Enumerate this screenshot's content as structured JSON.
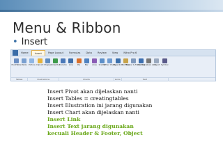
{
  "slide": {
    "title": "Menu & Ribbon",
    "bullet": "Insert"
  },
  "ribbon": {
    "tabs": [
      "Home",
      "Insert",
      "Page Layout",
      "Formulas",
      "Data",
      "Review",
      "View",
      "Nitro Pro 6"
    ],
    "active_tab": "Insert",
    "tools": [
      {
        "label": "PivotTable",
        "color": "#6b8fc4"
      },
      {
        "label": "Table",
        "color": "#7aa0d0"
      },
      {
        "label": "Picture",
        "color": "#8fb6e3"
      },
      {
        "label": "Clip Art",
        "color": "#e6b23a"
      },
      {
        "label": "Shapes",
        "color": "#5f8cc0"
      },
      {
        "label": "SmartArt",
        "color": "#3d9a4a"
      },
      {
        "label": "Column",
        "color": "#4a78b8"
      },
      {
        "label": "Line",
        "color": "#3f6ea9"
      },
      {
        "label": "Pie",
        "color": "#d96f2b"
      },
      {
        "label": "Bar",
        "color": "#4f82c0"
      },
      {
        "label": "Area",
        "color": "#8a5cb5"
      },
      {
        "label": "Scatter",
        "color": "#5c8fc9"
      },
      {
        "label": "Other Charts",
        "color": "#6f9bd0"
      },
      {
        "label": "Hyperlink",
        "color": "#3b70ad"
      },
      {
        "label": "Text Box",
        "color": "#c7a34a"
      },
      {
        "label": "Header & Footer",
        "color": "#7f99bd"
      },
      {
        "label": "WordArt",
        "color": "#3c6fb0"
      },
      {
        "label": "Signature Line",
        "color": "#777777"
      },
      {
        "label": "Object",
        "color": "#9aa9bf"
      },
      {
        "label": "Symbol",
        "color": "#5a5a8a"
      }
    ],
    "groups": [
      {
        "label": "Tables",
        "span": 2
      },
      {
        "label": "Illustrations",
        "span": 4
      },
      {
        "label": "Charts",
        "span": 7
      },
      {
        "label": "Links",
        "span": 1
      },
      {
        "label": "Text",
        "span": 6
      }
    ]
  },
  "notes": [
    {
      "text": "Insert Pivot akan dijelaskan nanti",
      "highlight": false
    },
    {
      "text": "Insert Tables  = creatingtables",
      "highlight": false
    },
    {
      "text": "Insert Illustration ini jarang digunakan",
      "highlight": false
    },
    {
      "text": "Insert Chart akan dijelaskan nanti",
      "highlight": false
    },
    {
      "text": "Insert Link",
      "highlight": true
    },
    {
      "text": "Insert Text jarang digunakan",
      "highlight": true
    },
    {
      "text": "kecuali Header & Footer, Object",
      "highlight": true
    }
  ]
}
